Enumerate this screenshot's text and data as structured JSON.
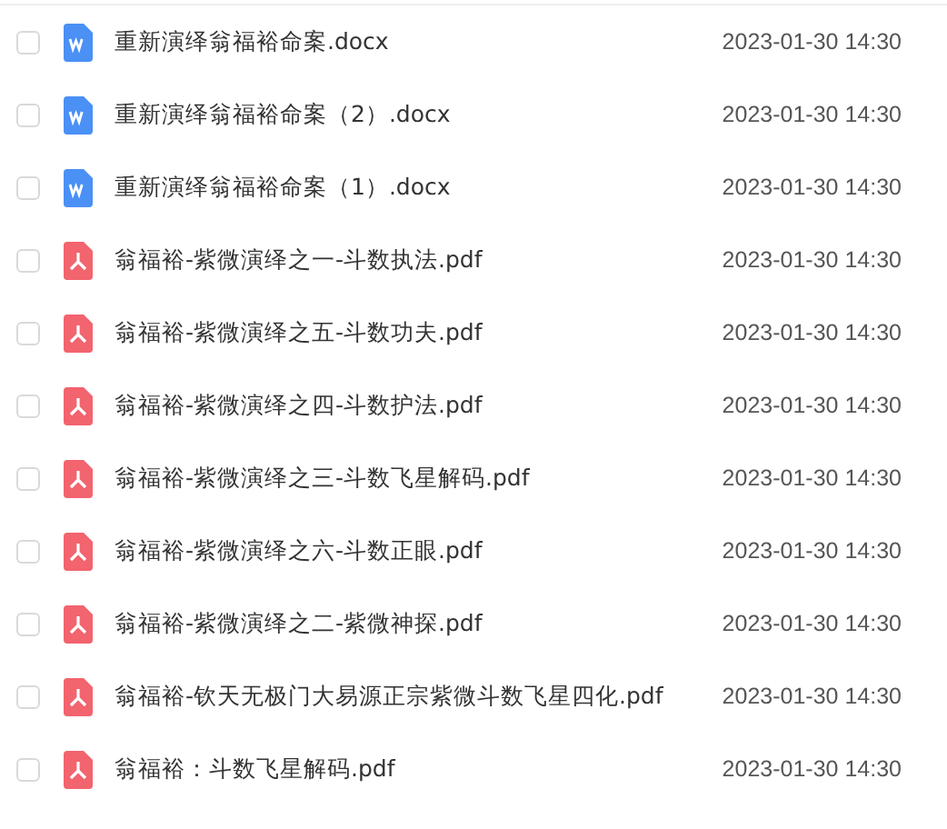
{
  "files": [
    {
      "kind": "word",
      "name": "重新演绎翁福裕命案.docx",
      "modified": "2023-01-30 14:30",
      "checked": false
    },
    {
      "kind": "word",
      "name": "重新演绎翁福裕命案（2）.docx",
      "modified": "2023-01-30 14:30",
      "checked": false
    },
    {
      "kind": "word",
      "name": "重新演绎翁福裕命案（1）.docx",
      "modified": "2023-01-30 14:30",
      "checked": false
    },
    {
      "kind": "pdf",
      "name": "翁福裕-紫微演绎之一-斗数执法.pdf",
      "modified": "2023-01-30 14:30",
      "checked": false
    },
    {
      "kind": "pdf",
      "name": "翁福裕-紫微演绎之五-斗数功夫.pdf",
      "modified": "2023-01-30 14:30",
      "checked": false
    },
    {
      "kind": "pdf",
      "name": "翁福裕-紫微演绎之四-斗数护法.pdf",
      "modified": "2023-01-30 14:30",
      "checked": false
    },
    {
      "kind": "pdf",
      "name": "翁福裕-紫微演绎之三-斗数飞星解码.pdf",
      "modified": "2023-01-30 14:30",
      "checked": false
    },
    {
      "kind": "pdf",
      "name": "翁福裕-紫微演绎之六-斗数正眼.pdf",
      "modified": "2023-01-30 14:30",
      "checked": false
    },
    {
      "kind": "pdf",
      "name": "翁福裕-紫微演绎之二-紫微神探.pdf",
      "modified": "2023-01-30 14:30",
      "checked": false
    },
    {
      "kind": "pdf",
      "name": "翁福裕-钦天无极门大易源正宗紫微斗数飞星四化.pdf",
      "modified": "2023-01-30 14:30",
      "checked": false
    },
    {
      "kind": "pdf",
      "name": "翁福裕：斗数飞星解码.pdf",
      "modified": "2023-01-30 14:30",
      "checked": false
    }
  ]
}
